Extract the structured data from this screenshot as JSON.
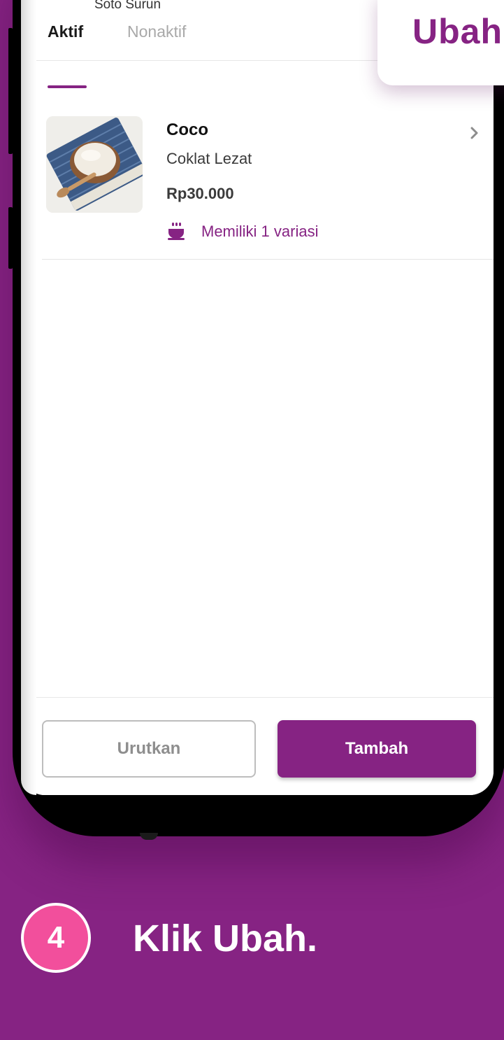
{
  "store": {
    "subtitle": "Soto Surun"
  },
  "tabs": [
    {
      "label": "Aktif",
      "active": true
    },
    {
      "label": "Nonaktif",
      "active": false
    }
  ],
  "products": [
    {
      "name": "Coco",
      "description": "Coklat Lezat",
      "price": "Rp30.000",
      "variant_note": "Memiliki 1 variasi"
    }
  ],
  "footer": {
    "sort_label": "Urutkan",
    "add_label": "Tambah"
  },
  "callout": {
    "label": "Ubah"
  },
  "instruction": {
    "step_number": "4",
    "text": "Klik Ubah."
  },
  "colors": {
    "brand": "#862383",
    "step_badge": "#f24f9c"
  },
  "icons": {
    "variant": "bowl-icon",
    "chevron": "chevron-right-icon"
  }
}
